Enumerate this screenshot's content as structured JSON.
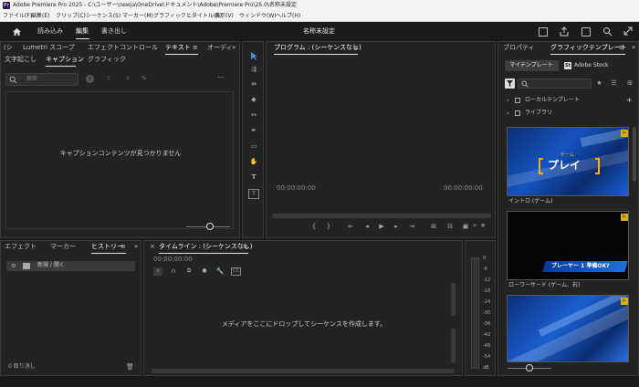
{
  "window": {
    "app_icon": "Pr",
    "title": "Adobe Premiere Pro 2025 - C:\\ユーザー\\newja\\OneDrive\\ドキュメント\\Adobe\\Premiere Pro\\25.0\\名称未設定"
  },
  "menu": [
    "ファイル(F)",
    "編集(E)",
    "クリップ(C)",
    "シーケンス(S)",
    "マーカー(M)",
    "グラフィックとタイトル(G)",
    "表示(V)",
    "ウィンドウ(W)",
    "ヘルプ(H)"
  ],
  "header": {
    "tabs": [
      "読み込み",
      "編集",
      "書き出し"
    ],
    "project_title": "名称未設定"
  },
  "left_panel": {
    "tabs_row1": [
      "(シ",
      "Lumetri スコープ",
      "エフェクトコントロール",
      "テキスト",
      "オーディ"
    ],
    "tabs_row2": [
      "文字起こし",
      "キャプション",
      "グラフィック"
    ],
    "search_placeholder": "検索",
    "empty_message": "キャプションコンテンツが見つかりません"
  },
  "program_monitor": {
    "title": "プログラム : (シーケンスなし)",
    "timecode_left": "00:00:00:00",
    "timecode_right": "00:00:00:00"
  },
  "project_panel": {
    "tabs": [
      "エフェクト",
      "マーカー",
      "ヒストリー"
    ],
    "history_item": "新規 / 開く",
    "undo_count": "0 取り消し"
  },
  "timeline": {
    "title": "タイムライン : (シーケンスなし)",
    "timecode": "00:00:00:00",
    "empty_message": "メディアをここにドロップしてシーケンスを作成します。"
  },
  "audio_meter": {
    "labels": [
      "0",
      "-6",
      "-12",
      "-18",
      "-24",
      "-30",
      "-36",
      "-42",
      "-48",
      "-54",
      "dB"
    ]
  },
  "essential_graphics": {
    "tabs": [
      "プロパティ",
      "グラフィックテンプレート"
    ],
    "sub_tabs": [
      "マイテンプレート",
      "Adobe Stock"
    ],
    "search_placeholder": "",
    "tree": [
      "ローカルテンプレート",
      "ライブラリ"
    ],
    "templates": [
      {
        "name": "イントロ (ゲーム)",
        "overlay": "プレイ",
        "caption": "ゲーム"
      },
      {
        "name": "ローワーサード (ゲーム、右)",
        "overlay": "プレーヤー 1 準備OK?",
        "caption": ""
      },
      {
        "name": "",
        "overlay": "",
        "caption": ""
      }
    ]
  },
  "colors": {
    "accent_blue": "#2d8ceb",
    "panel_bg": "#232323",
    "app_bg": "#1b1b1b"
  }
}
